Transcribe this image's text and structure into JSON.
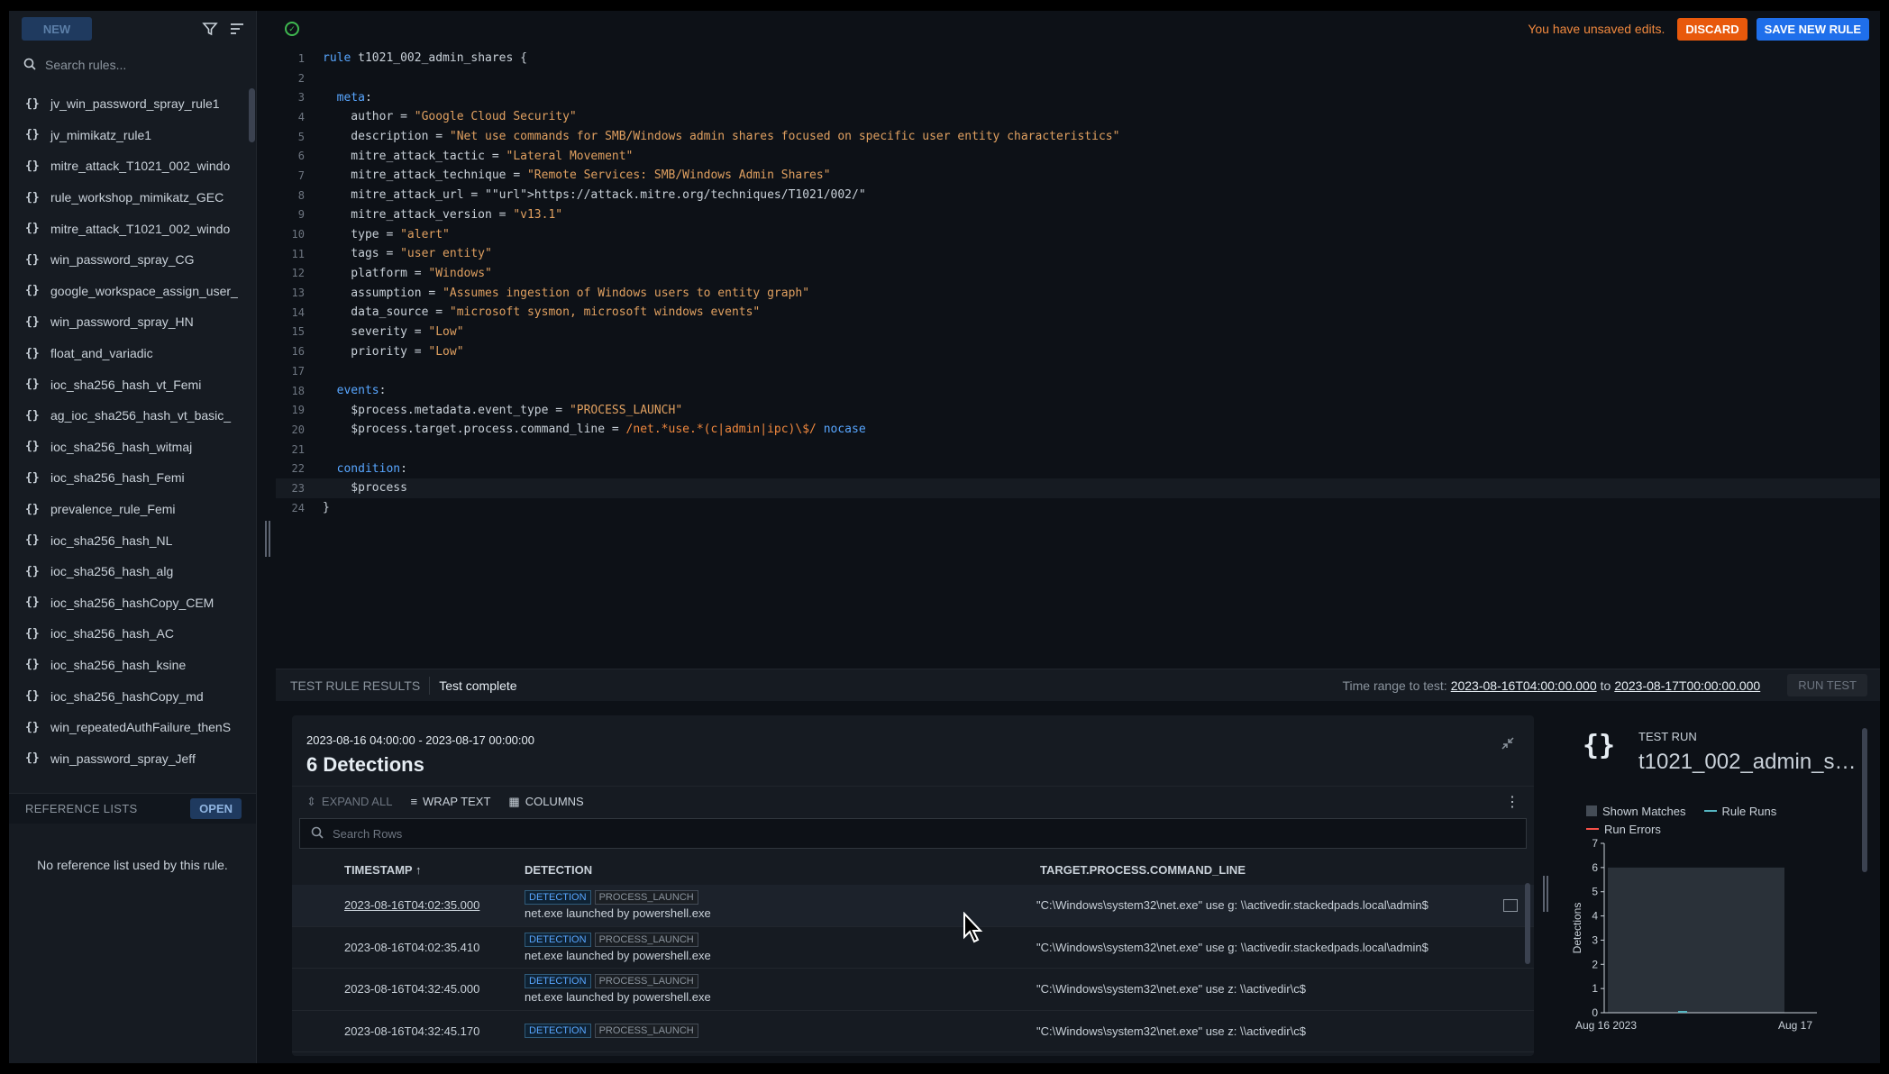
{
  "sidebar": {
    "new_label": "NEW",
    "search_placeholder": "Search rules...",
    "rules": [
      "jv_win_password_spray_rule1",
      "jv_mimikatz_rule1",
      "mitre_attack_T1021_002_windo",
      "rule_workshop_mimikatz_GEC",
      "mitre_attack_T1021_002_windo",
      "win_password_spray_CG",
      "google_workspace_assign_user_",
      "win_password_spray_HN",
      "float_and_variadic",
      "ioc_sha256_hash_vt_Femi",
      "ag_ioc_sha256_hash_vt_basic_",
      "ioc_sha256_hash_witmaj",
      "ioc_sha256_hash_Femi",
      "prevalence_rule_Femi",
      "ioc_sha256_hash_NL",
      "ioc_sha256_hash_alg",
      "ioc_sha256_hashCopy_CEM",
      "ioc_sha256_hash_AC",
      "ioc_sha256_hash_ksine",
      "ioc_sha256_hashCopy_md",
      "win_repeatedAuthFailure_thenS",
      "win_password_spray_Jeff"
    ],
    "reference_lists_title": "REFERENCE LISTS",
    "open_label": "OPEN",
    "no_reference_text": "No reference list used by this rule."
  },
  "editor": {
    "unsaved_text": "You have unsaved edits.",
    "discard_label": "DISCARD",
    "save_label": "SAVE NEW RULE",
    "lines": [
      {
        "n": "1",
        "t": "rule t1021_002_admin_shares {"
      },
      {
        "n": "2",
        "t": ""
      },
      {
        "n": "3",
        "t": "  meta:"
      },
      {
        "n": "4",
        "t": "    author = \"Google Cloud Security\""
      },
      {
        "n": "5",
        "t": "    description = \"Net use commands for SMB/Windows admin shares focused on specific user entity characteristics\""
      },
      {
        "n": "6",
        "t": "    mitre_attack_tactic = \"Lateral Movement\""
      },
      {
        "n": "7",
        "t": "    mitre_attack_technique = \"Remote Services: SMB/Windows Admin Shares\""
      },
      {
        "n": "8",
        "t": "    mitre_attack_url = \"https://attack.mitre.org/techniques/T1021/002/\""
      },
      {
        "n": "9",
        "t": "    mitre_attack_version = \"v13.1\""
      },
      {
        "n": "10",
        "t": "    type = \"alert\""
      },
      {
        "n": "11",
        "t": "    tags = \"user entity\""
      },
      {
        "n": "12",
        "t": "    platform = \"Windows\""
      },
      {
        "n": "13",
        "t": "    assumption = \"Assumes ingestion of Windows users to entity graph\""
      },
      {
        "n": "14",
        "t": "    data_source = \"microsoft sysmon, microsoft windows events\""
      },
      {
        "n": "15",
        "t": "    severity = \"Low\""
      },
      {
        "n": "16",
        "t": "    priority = \"Low\""
      },
      {
        "n": "17",
        "t": ""
      },
      {
        "n": "18",
        "t": "  events:"
      },
      {
        "n": "19",
        "t": "    $process.metadata.event_type = \"PROCESS_LAUNCH\""
      },
      {
        "n": "20",
        "t": "    $process.target.process.command_line = /net.*use.*(c|admin|ipc)\\$/ nocase"
      },
      {
        "n": "21",
        "t": ""
      },
      {
        "n": "22",
        "t": "  condition:"
      },
      {
        "n": "23",
        "t": "    $process"
      },
      {
        "n": "24",
        "t": "}"
      }
    ]
  },
  "results": {
    "title": "TEST RULE RESULTS",
    "status": "Test complete",
    "time_range_label": "Time range to test:",
    "range_start": "2023-08-16T04:00:00.000",
    "range_to": "to",
    "range_end": "2023-08-17T00:00:00.000",
    "run_test_label": "RUN TEST"
  },
  "detections": {
    "range": "2023-08-16 04:00:00 - 2023-08-17 00:00:00",
    "count": "6 Detections",
    "expand_all": "EXPAND ALL",
    "wrap_text": "WRAP TEXT",
    "columns": "COLUMNS",
    "search_placeholder": "Search Rows",
    "col_timestamp": "TIMESTAMP ↑",
    "col_detection": "DETECTION",
    "col_command": "TARGET.PROCESS.COMMAND_LINE",
    "badge1": "DETECTION",
    "badge2": "PROCESS_LAUNCH",
    "rows": [
      {
        "ts": "2023-08-16T04:02:35.000",
        "sub": "net.exe launched by powershell.exe",
        "cmd": "\"C:\\Windows\\system32\\net.exe\" use g: \\\\activedir.stackedpads.local\\admin$"
      },
      {
        "ts": "2023-08-16T04:02:35.410",
        "sub": "net.exe launched by powershell.exe",
        "cmd": "\"C:\\Windows\\system32\\net.exe\" use g: \\\\activedir.stackedpads.local\\admin$"
      },
      {
        "ts": "2023-08-16T04:32:45.000",
        "sub": "net.exe launched by powershell.exe",
        "cmd": "\"C:\\Windows\\system32\\net.exe\" use z: \\\\activedir\\c$"
      },
      {
        "ts": "2023-08-16T04:32:45.170",
        "sub": "",
        "cmd": "\"C:\\Windows\\system32\\net.exe\" use z: \\\\activedir\\c$"
      }
    ]
  },
  "test_run": {
    "label": "TEST RUN",
    "name": "t1021_002_admin_shares",
    "legend_shown": "Shown Matches",
    "legend_runs": "Rule Runs",
    "legend_errors": "Run Errors",
    "ylabel": "Detections",
    "x_start": "Aug 16 2023",
    "x_end": "Aug 17",
    "colors": {
      "shown": "#444c56",
      "runs": "#56b6c2",
      "errors": "#f85149"
    }
  },
  "chart_data": {
    "type": "area",
    "title": "",
    "xlabel": "",
    "ylabel": "Detections",
    "x_tick_labels": [
      "Aug 16 2023",
      "Aug 17"
    ],
    "y_ticks": [
      0,
      1,
      2,
      3,
      4,
      5,
      6,
      7
    ],
    "ylim": [
      0,
      7
    ],
    "series": [
      {
        "name": "Shown Matches",
        "values": [
          6,
          6
        ]
      },
      {
        "name": "Rule Runs",
        "values": [
          0,
          0
        ]
      },
      {
        "name": "Run Errors",
        "values": [
          0,
          0
        ]
      }
    ],
    "legend": "top-left"
  }
}
